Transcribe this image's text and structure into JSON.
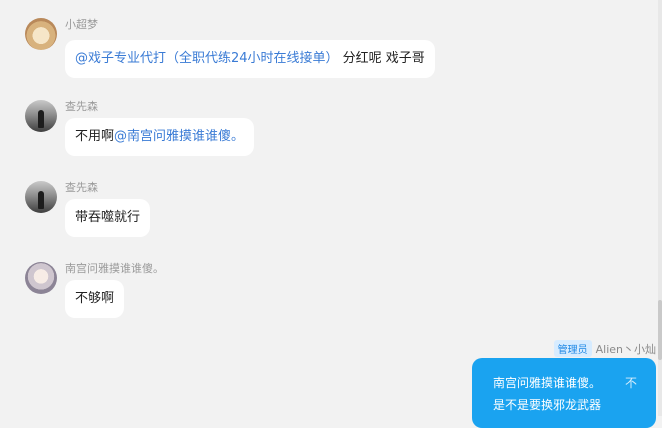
{
  "messages": [
    {
      "sender": "小超梦",
      "mention": "@戏子专业代打（全职代练24小时在线接单）",
      "text": " 分红呢  戏子哥",
      "avatar_icon": "dog-avatar-icon"
    },
    {
      "sender": "查先森",
      "text": "不用啊",
      "mention": "@南宫问雅摸谁谁傻。",
      "avatar_icon": "dark-figure-avatar-icon"
    },
    {
      "sender": "查先森",
      "text": "带吞噬就行",
      "avatar_icon": "dark-figure-avatar-icon"
    },
    {
      "sender": "南宫问雅摸谁谁傻。",
      "text": "不够啊",
      "avatar_icon": "anime-avatar-icon"
    }
  ],
  "self_message": {
    "role_badge": "管理员",
    "sender": "Alien丶小灿",
    "line1": "南宫问雅摸谁谁傻。",
    "line1_tail": "不",
    "line2": "是不是要换邪龙武器"
  },
  "colors": {
    "background": "#f2f2f2",
    "mention": "#3a7bd5",
    "self_bubble": "#1aa3f0",
    "badge_bg": "#d7ecff",
    "badge_text": "#1e88e5"
  }
}
